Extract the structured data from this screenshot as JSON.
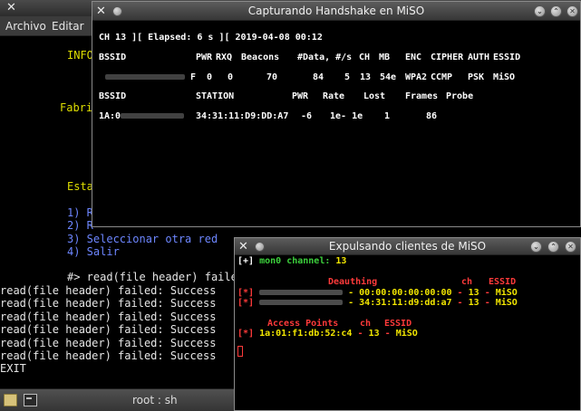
{
  "bg_terminal": {
    "menu": [
      "Archivo",
      "Editar"
    ],
    "lines": {
      "info": "INFO",
      "fabri": "Fabri",
      "esta": "Esta",
      "opt1": "1) R",
      "opt2": "2) R",
      "opt3": "3) Seleccionar otra red",
      "opt4": "4) Salir",
      "prompt": "#> read(file header) failed",
      "err": "read(file header) failed: Success",
      "exit": "EXIT"
    }
  },
  "taskbar": {
    "label": "root : sh"
  },
  "handshake_window": {
    "title": "Capturando Handshake en MiSO",
    "status_line": "CH 13 ][ Elapsed: 6 s ][ 2019-04-08 00:12",
    "ap_headers": [
      "BSSID",
      "PWR",
      "RXQ",
      "Beacons",
      "#Data, #/s",
      "CH",
      "MB",
      "ENC",
      "CIPHER",
      "AUTH",
      "ESSID"
    ],
    "ap_row": {
      "bssid_tail": "F",
      "pwr": "0",
      "rxq": "0",
      "beacons": "70",
      "data": "84",
      "per_s": "5",
      "ch": "13",
      "mb": "54e",
      "enc": "WPA2",
      "cipher": "CCMP",
      "auth": "PSK",
      "essid": "MiSO"
    },
    "st_headers": [
      "BSSID",
      "STATION",
      "PWR",
      "Rate",
      "Lost",
      "Frames",
      "Probe"
    ],
    "st_row": {
      "bssid_head": "1A:0",
      "station": "34:31:11:D9:DD:A7",
      "pwr": "-6",
      "rate": "1e- 1e",
      "lost": "1",
      "frames": "86"
    }
  },
  "deauth_window": {
    "title": "Expulsando clientes de MiSO",
    "channel_prefix": "[+]",
    "channel_label": "mon0 channel:",
    "channel_value": "13",
    "deauth_header": "Deauthing",
    "ch_header": "ch",
    "essid_header": "ESSID",
    "rows": [
      {
        "marker": "[*]",
        "tail": "- 00:00:00:00:00:00",
        "sep1": "-",
        "ch": "13",
        "sep2": "-",
        "essid": "MiSO"
      },
      {
        "marker": "[*]",
        "tail": "- 34:31:11:d9:dd:a7",
        "sep1": "-",
        "ch": "13",
        "sep2": "-",
        "essid": "MiSO"
      }
    ],
    "ap_header": "Access Points",
    "ap_row": {
      "marker": "[*]",
      "bssid": "1a:01:f1:db:52:c4",
      "sep1": "-",
      "ch": "13",
      "sep2": "-",
      "essid": "MiSO"
    }
  },
  "colors": {
    "green": "#3ccf3c",
    "yellow": "#f2e600",
    "red": "#ff3a3a",
    "blue": "#6d86ff"
  }
}
